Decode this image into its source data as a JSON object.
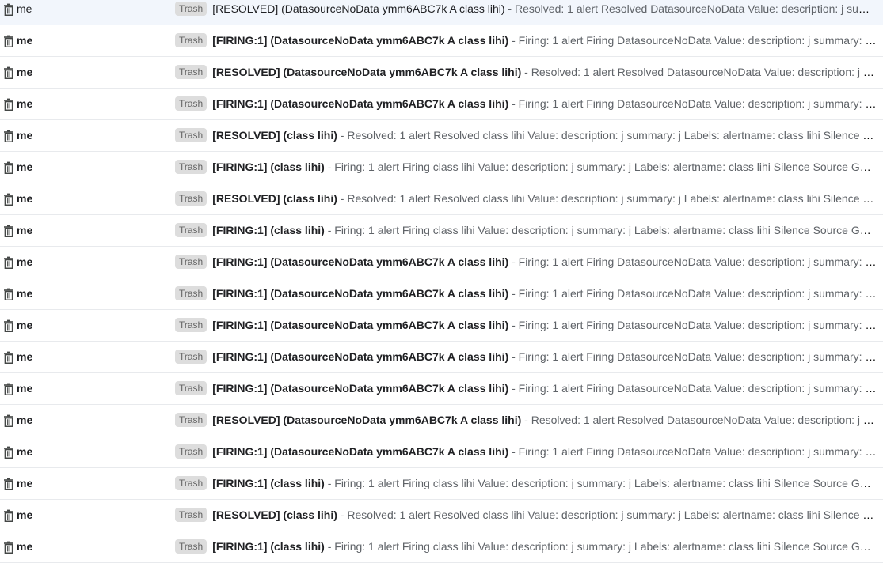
{
  "label_chip": "Trash",
  "separator": " - ",
  "emails": [
    {
      "sender": "me",
      "subject": "[RESOLVED] (DatasourceNoData ymm6ABC7k A class lihi)",
      "snippet": "Resolved: 1 alert Resolved DatasourceNoData Value: description: j summary: j Labels: alertname: DatasourceNoData",
      "unread": false
    },
    {
      "sender": "me",
      "subject": "[FIRING:1] (DatasourceNoData ymm6ABC7k A class lihi)",
      "snippet": "Firing: 1 alert Firing DatasourceNoData Value: description: j summary: j Labels: alertname: DatasourceNoData",
      "unread": true
    },
    {
      "sender": "me",
      "subject": "[RESOLVED] (DatasourceNoData ymm6ABC7k A class lihi)",
      "snippet": "Resolved: 1 alert Resolved DatasourceNoData Value: description: j summary: j Labels: alertname: DatasourceNoData",
      "unread": true
    },
    {
      "sender": "me",
      "subject": "[FIRING:1] (DatasourceNoData ymm6ABC7k A class lihi)",
      "snippet": "Firing: 1 alert Firing DatasourceNoData Value: description: j summary: j Labels: alertname: DatasourceNoData",
      "unread": true
    },
    {
      "sender": "me",
      "subject": "[RESOLVED] (class lihi)",
      "snippet": "Resolved: 1 alert Resolved class lihi Value: description: j summary: j Labels: alertname: class lihi Silence Source Go to dashboard",
      "unread": true
    },
    {
      "sender": "me",
      "subject": "[FIRING:1] (class lihi)",
      "snippet": "Firing: 1 alert Firing class lihi Value: description: j summary: j Labels: alertname: class lihi Silence Source Go to dashboard",
      "unread": true
    },
    {
      "sender": "me",
      "subject": "[RESOLVED] (class lihi)",
      "snippet": "Resolved: 1 alert Resolved class lihi Value: description: j summary: j Labels: alertname: class lihi Silence Source Go to dashboard",
      "unread": true
    },
    {
      "sender": "me",
      "subject": "[FIRING:1] (class lihi)",
      "snippet": "Firing: 1 alert Firing class lihi Value: description: j summary: j Labels: alertname: class lihi Silence Source Go to dashboard",
      "unread": true
    },
    {
      "sender": "me",
      "subject": "[FIRING:1] (DatasourceNoData ymm6ABC7k A class lihi)",
      "snippet": "Firing: 1 alert Firing DatasourceNoData Value: description: j summary: j Labels: alertname: DatasourceNoData",
      "unread": true
    },
    {
      "sender": "me",
      "subject": "[FIRING:1] (DatasourceNoData ymm6ABC7k A class lihi)",
      "snippet": "Firing: 1 alert Firing DatasourceNoData Value: description: j summary: j Labels: alertname: DatasourceNoData",
      "unread": true
    },
    {
      "sender": "me",
      "subject": "[FIRING:1] (DatasourceNoData ymm6ABC7k A class lihi)",
      "snippet": "Firing: 1 alert Firing DatasourceNoData Value: description: j summary: j Labels: alertname: DatasourceNoData",
      "unread": true
    },
    {
      "sender": "me",
      "subject": "[FIRING:1] (DatasourceNoData ymm6ABC7k A class lihi)",
      "snippet": "Firing: 1 alert Firing DatasourceNoData Value: description: j summary: j Labels: alertname: DatasourceNoData",
      "unread": true
    },
    {
      "sender": "me",
      "subject": "[FIRING:1] (DatasourceNoData ymm6ABC7k A class lihi)",
      "snippet": "Firing: 1 alert Firing DatasourceNoData Value: description: j summary: j Labels: alertname: DatasourceNoData",
      "unread": true
    },
    {
      "sender": "me",
      "subject": "[RESOLVED] (DatasourceNoData ymm6ABC7k A class lihi)",
      "snippet": "Resolved: 1 alert Resolved DatasourceNoData Value: description: j summary: j Labels: alertname: DatasourceNoData",
      "unread": true
    },
    {
      "sender": "me",
      "subject": "[FIRING:1] (DatasourceNoData ymm6ABC7k A class lihi)",
      "snippet": "Firing: 1 alert Firing DatasourceNoData Value: description: j summary: j Labels: alertname: DatasourceNoData",
      "unread": true
    },
    {
      "sender": "me",
      "subject": "[FIRING:1] (class lihi)",
      "snippet": "Firing: 1 alert Firing class lihi Value: description: j summary: j Labels: alertname: class lihi Silence Source Go to dashboard",
      "unread": true
    },
    {
      "sender": "me",
      "subject": "[RESOLVED] (class lihi)",
      "snippet": "Resolved: 1 alert Resolved class lihi Value: description: j summary: j Labels: alertname: class lihi Silence Source Go to dashboard",
      "unread": true
    },
    {
      "sender": "me",
      "subject": "[FIRING:1] (class lihi)",
      "snippet": "Firing: 1 alert Firing class lihi Value: description: j summary: j Labels: alertname: class lihi Silence Source Go to dashboard",
      "unread": true
    }
  ]
}
